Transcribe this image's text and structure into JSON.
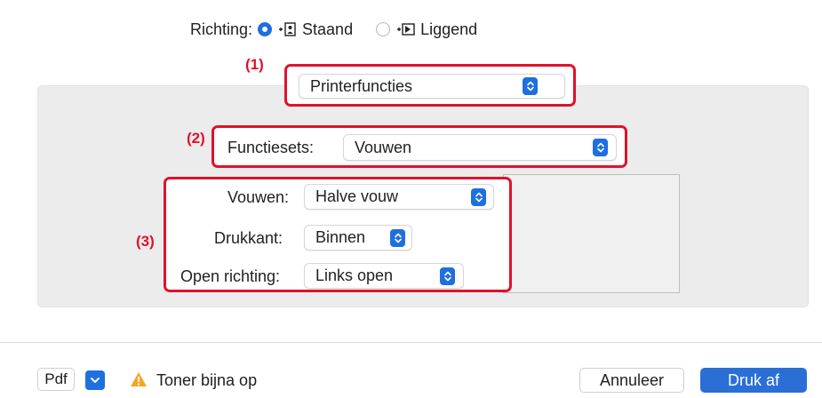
{
  "orientation": {
    "label": "Richting:",
    "options": [
      {
        "label": "Staand",
        "selected": true
      },
      {
        "label": "Liggend",
        "selected": false
      }
    ]
  },
  "callouts": {
    "one": "(1)",
    "two": "(2)",
    "three": "(3)"
  },
  "printer_features_menu": {
    "value": "Printerfuncties"
  },
  "feature_sets": {
    "label": "Functiesets:",
    "value": "Vouwen"
  },
  "folding": {
    "fold": {
      "label": "Vouwen:",
      "value": "Halve vouw"
    },
    "print_side": {
      "label": "Drukkant:",
      "value": "Binnen"
    },
    "open_direction": {
      "label": "Open richting:",
      "value": "Links open"
    }
  },
  "footer": {
    "pdf_label": "Pdf",
    "warning_text": "Toner bijna op",
    "cancel_label": "Annuleer",
    "print_label": "Druk af"
  },
  "colors": {
    "accent": "#1e6fe0",
    "callout": "#e0112b",
    "warning": "#f5a623"
  },
  "icons": [
    "portrait-orientation-icon",
    "landscape-orientation-icon",
    "popup-arrows-icon",
    "chevron-down-icon",
    "warning-icon"
  ]
}
